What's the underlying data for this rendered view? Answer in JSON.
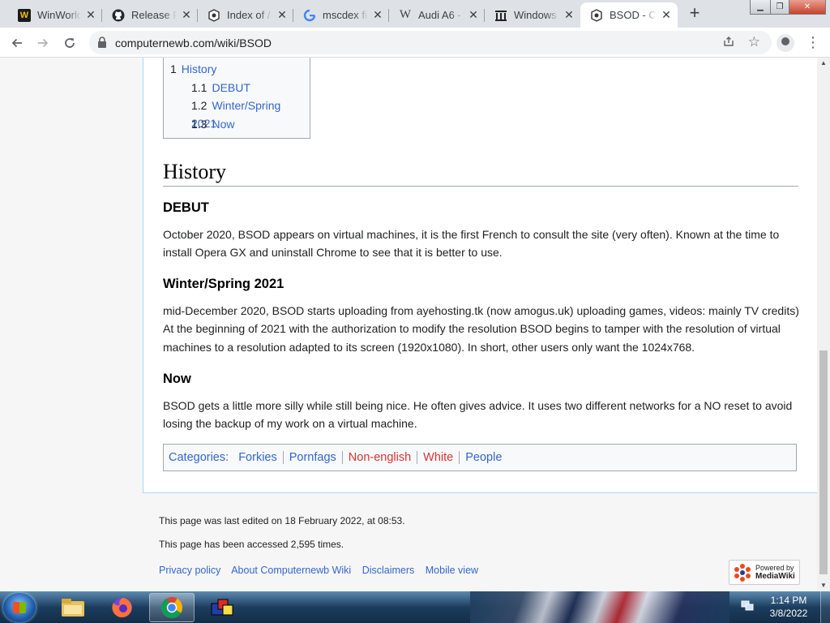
{
  "browser": {
    "tabs": [
      {
        "title": "WinWorldPC",
        "icon": "winworld-icon",
        "active": false
      },
      {
        "title": "Release Pr",
        "icon": "github-icon",
        "active": false
      },
      {
        "title": "Index of /",
        "icon": "computernewb-icon",
        "active": false
      },
      {
        "title": "mscdex fil",
        "icon": "google-icon",
        "active": false
      },
      {
        "title": "Audi A6 -",
        "icon": "wikipedia-icon",
        "active": false
      },
      {
        "title": "Windows",
        "icon": "archive-icon",
        "active": false
      },
      {
        "title": "BSOD - Co",
        "icon": "computernewb-icon",
        "active": true
      }
    ],
    "url": "computernewb.com/wiki/BSOD"
  },
  "toc": {
    "items": [
      {
        "num": "1",
        "label": "History"
      },
      {
        "num": "1.1",
        "label": "DEBUT"
      },
      {
        "num": "1.2",
        "label": "Winter/Spring 2021"
      },
      {
        "num": "1.3",
        "label": "Now"
      }
    ]
  },
  "article": {
    "heading": "History",
    "sections": [
      {
        "title": "DEBUT",
        "text": "October 2020, BSOD appears on virtual machines, it is the first French to consult the site (very often). Known at the time to install Opera GX and uninstall Chrome to see that it is better to use."
      },
      {
        "title": "Winter/Spring 2021",
        "text": "mid-December 2020, BSOD starts uploading from ayehosting.tk (now amogus.uk) uploading games, videos: mainly TV credits) At the beginning of 2021 with the authorization to modify the resolution BSOD begins to tamper with the resolution of virtual machines to a resolution adapted to its screen (1920x1080). In short, other users only want the 1024x768."
      },
      {
        "title": "Now",
        "text": "BSOD gets a little more silly while still being nice. He often gives advice. It uses two different networks for a NO reset to avoid losing the backup of my work on a virtual machine."
      }
    ],
    "categories_label": "Categories",
    "categories": [
      {
        "label": "Forkies",
        "missing": false
      },
      {
        "label": "Pornfags",
        "missing": false
      },
      {
        "label": "Non-english",
        "missing": true
      },
      {
        "label": "White",
        "missing": true
      },
      {
        "label": "People",
        "missing": false
      }
    ]
  },
  "footer": {
    "last_edited": "This page was last edited on 18 February 2022, at 08:53.",
    "accessed": "This page has been accessed 2,595 times.",
    "links": [
      "Privacy policy",
      "About Computernewb Wiki",
      "Disclaimers",
      "Mobile view"
    ],
    "powered_top": "Powered by",
    "powered_bottom": "MediaWiki"
  },
  "taskbar": {
    "time": "1:14 PM",
    "date": "3/8/2022",
    "buttons": [
      "explorer-icon",
      "firefox-icon",
      "chrome-icon",
      "vm-app-icon"
    ]
  },
  "colors": {
    "link": "#3366cc",
    "missing_link": "#d73333",
    "content_border": "#a7d7f9"
  }
}
